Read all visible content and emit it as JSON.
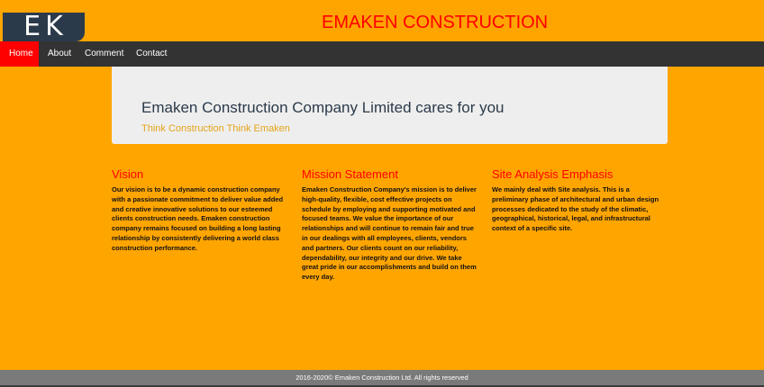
{
  "header": {
    "logo_text_left": "E",
    "logo_text_right": "K",
    "title": "EMAKEN CONSTRUCTION"
  },
  "nav": {
    "items": [
      {
        "label": "Home",
        "active": true
      },
      {
        "label": "About",
        "active": false
      },
      {
        "label": "Comment",
        "active": false
      },
      {
        "label": "Contact",
        "active": false
      }
    ]
  },
  "hero": {
    "heading": "Emaken Construction Company Limited cares for you",
    "subheading": "Think Construction Think Emaken"
  },
  "sections": [
    {
      "title": "Vision",
      "body": "Our vision is to be a dynamic construction company with a passionate commitment to deliver value added and creative innovative solutions to our esteemed clients construction needs. Emaken construction company remains focused on building a long lasting relationship by consistently delivering a world class construction performance."
    },
    {
      "title": "Mission Statement",
      "body": "Emaken Construction Company's mission is to deliver high-quality, flexible, cost effective projects on schedule by employing and supporting motivated and focused teams. We value the importance of our relationships and will continue to remain fair and true in our dealings with all employees, clients, vendors and partners. Our clients count on our reliability, dependability, our integrity and our drive. We take great pride in our accomplishments and build on them every day."
    },
    {
      "title": "Site Analysis Emphasis",
      "body": "We mainly deal with Site analysis. This is a preliminary phase of architectural and urban design processes dedicated to the study of the climatic, geographical, historical, legal, and infrastructural context of a specific site."
    }
  ],
  "footer": {
    "text": "2016-2020© Emaken Construction Ltd. All rights reserved"
  },
  "colors": {
    "background": "#ffa500",
    "navbar": "#333333",
    "active_nav": "#ff0000",
    "title": "#ff0000",
    "hero_bg": "#eeeeee",
    "hero_sub": "#e4a419",
    "footer": "#7a7a7a"
  }
}
